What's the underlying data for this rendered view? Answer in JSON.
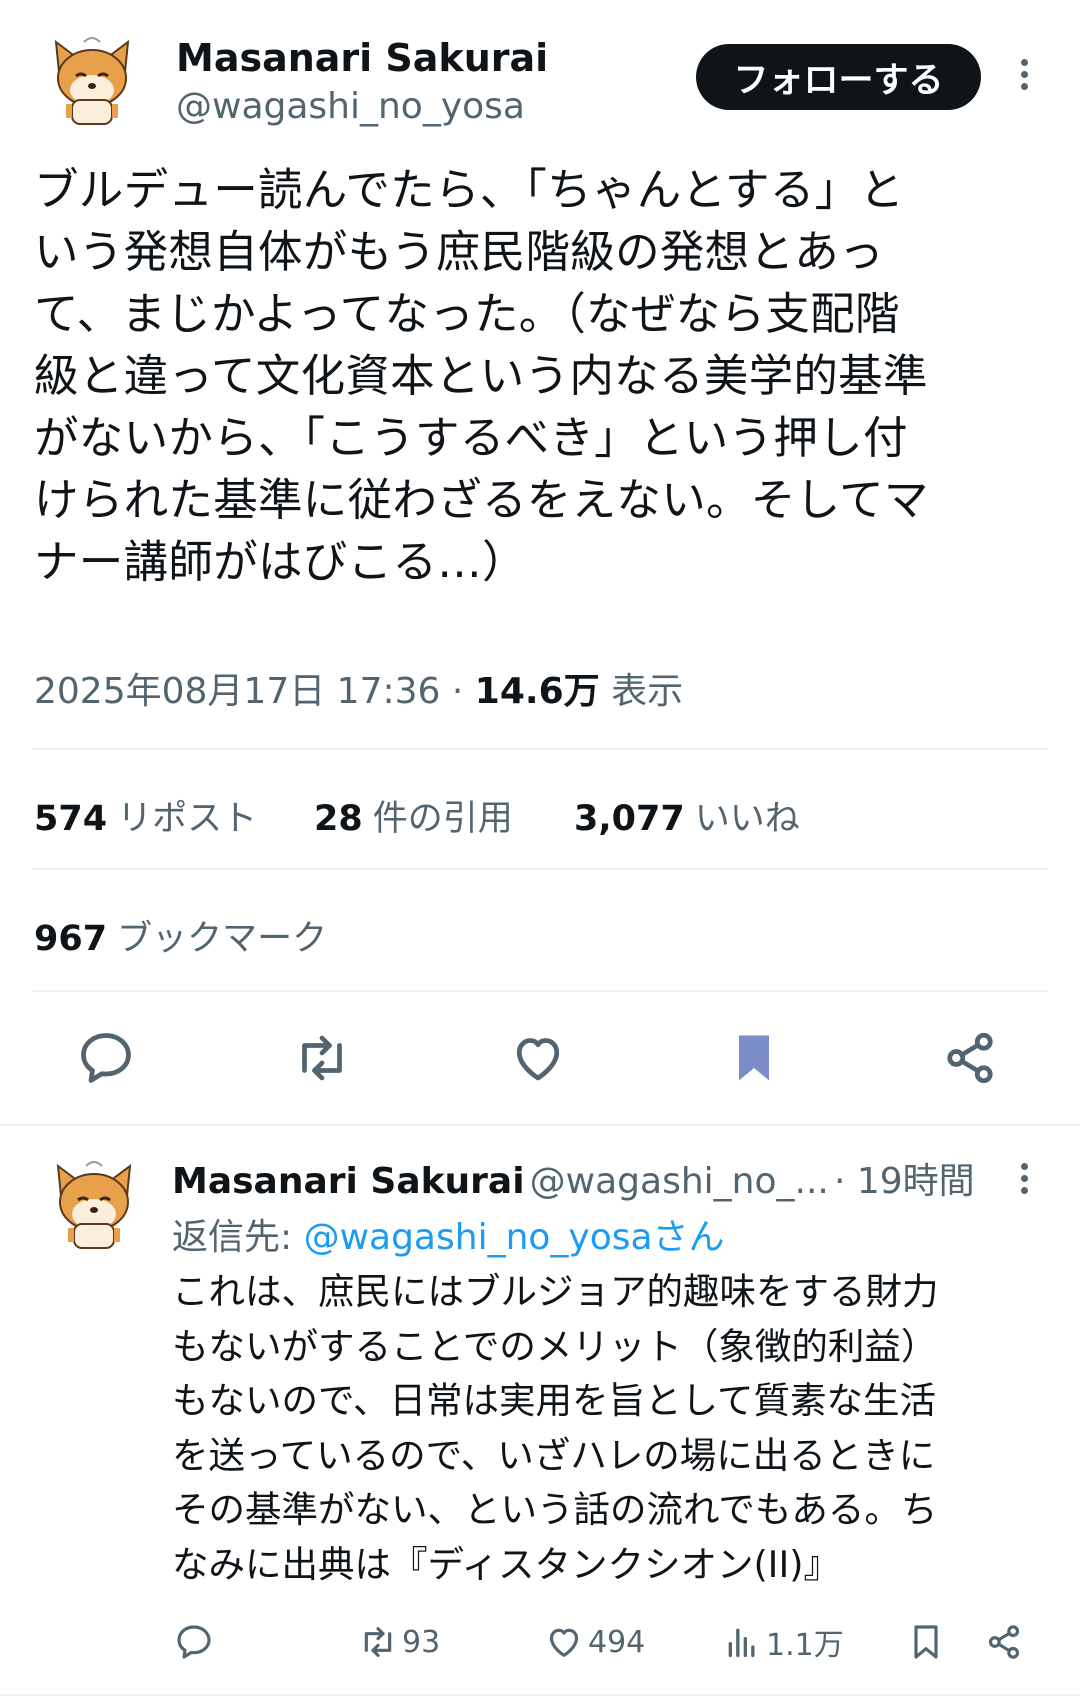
{
  "tweet": {
    "author_name": "Masanari Sakurai",
    "author_handle": "@wagashi_no_yosa",
    "follow_label": "フォローする",
    "text": "ブルデュー読んでたら、「ちゃんとする」と\nいう発想自体がもう庶民階級の発想とあっ\nて、まじかよってなった。（なぜなら支配階\n級と違って文化資本という内なる美学的基準\nがないから、「こうするべき」という押し付\nけられた基準に従わざるをえない。そしてマ\nナー講師がはびこる…）",
    "timestamp": "2025年08月17日 17:36",
    "separator": "·",
    "views_count": "14.6万",
    "views_label": "表示",
    "reposts_count": "574",
    "reposts_label": "リポスト",
    "quotes_count": "28",
    "quotes_label": "件の引用",
    "likes_count": "3,077",
    "likes_label": "いいね",
    "bookmarks_count": "967",
    "bookmarks_label": "ブックマーク"
  },
  "icons": {
    "reply": "reply-icon",
    "retweet": "retweet-icon",
    "like": "heart-icon",
    "bookmark": "bookmark-icon",
    "share": "share-icon",
    "views": "views-icon",
    "more": "more-icon"
  },
  "colors": {
    "accent_link": "#1d9bf0",
    "bookmark_active": "#7b8dc8",
    "follow_bg": "#0f1419",
    "secondary_text": "#536471"
  },
  "reply": {
    "author_name": "Masanari Sakurai",
    "author_handle": "@wagashi_no_...",
    "time": "· 19時間",
    "reply_to_prefix": "返信先: ",
    "reply_to_handle": "@wagashi_no_yosaさん",
    "text": "これは、庶民にはブルジョア的趣味をする財力\nもないがすることでのメリット（象徴的利益）\nもないので、日常は実用を旨として質素な生活\nを送っているので、いざハレの場に出るときに\nその基準がない、という話の流れでもある。ち\nなみに出典は『ディスタンクシオン(II)』",
    "retweets": "93",
    "likes": "494",
    "views": "1.1万"
  }
}
